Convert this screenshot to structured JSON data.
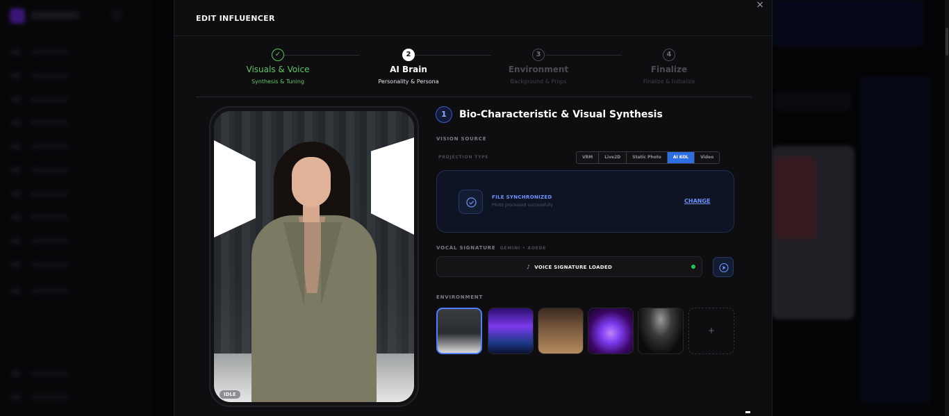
{
  "modal": {
    "title": "EDIT INFLUENCER",
    "close_label": "×"
  },
  "stepper": [
    {
      "number": "✓",
      "title": "Visuals & Voice",
      "subtitle": "Synthesis & Tuning",
      "state": "done"
    },
    {
      "number": "2",
      "title": "AI Brain",
      "subtitle": "Personality & Persona",
      "state": "active"
    },
    {
      "number": "3",
      "title": "Environment",
      "subtitle": "Background & Props",
      "state": "pending"
    },
    {
      "number": "4",
      "title": "Finalize",
      "subtitle": "Finalize & Initialize",
      "state": "pending"
    }
  ],
  "preview": {
    "status_badge": "IDLE"
  },
  "section": {
    "number": "1",
    "title": "Bio-Characteristic & Visual Synthesis"
  },
  "vision_source": {
    "label": "VISION SOURCE",
    "projection_label": "PROJECTION TYPE",
    "options": [
      "VRM",
      "Live2D",
      "Static Photo",
      "AI KOL",
      "Video"
    ],
    "selected": "AI KOL"
  },
  "file": {
    "status_title": "FILE SYNCHRONIZED",
    "status_subtitle": "Photo processed successfully",
    "change_label": "CHANGE"
  },
  "vocal": {
    "label": "VOCAL SIGNATURE",
    "engine": "GEMINI • AOEDE",
    "status": "VOICE SIGNATURE LOADED",
    "status_color": "#22c55e"
  },
  "environment": {
    "label": "ENVIRONMENT",
    "add_label": "+"
  },
  "colors": {
    "accent": "#2f6fe6",
    "success": "#65c466"
  }
}
